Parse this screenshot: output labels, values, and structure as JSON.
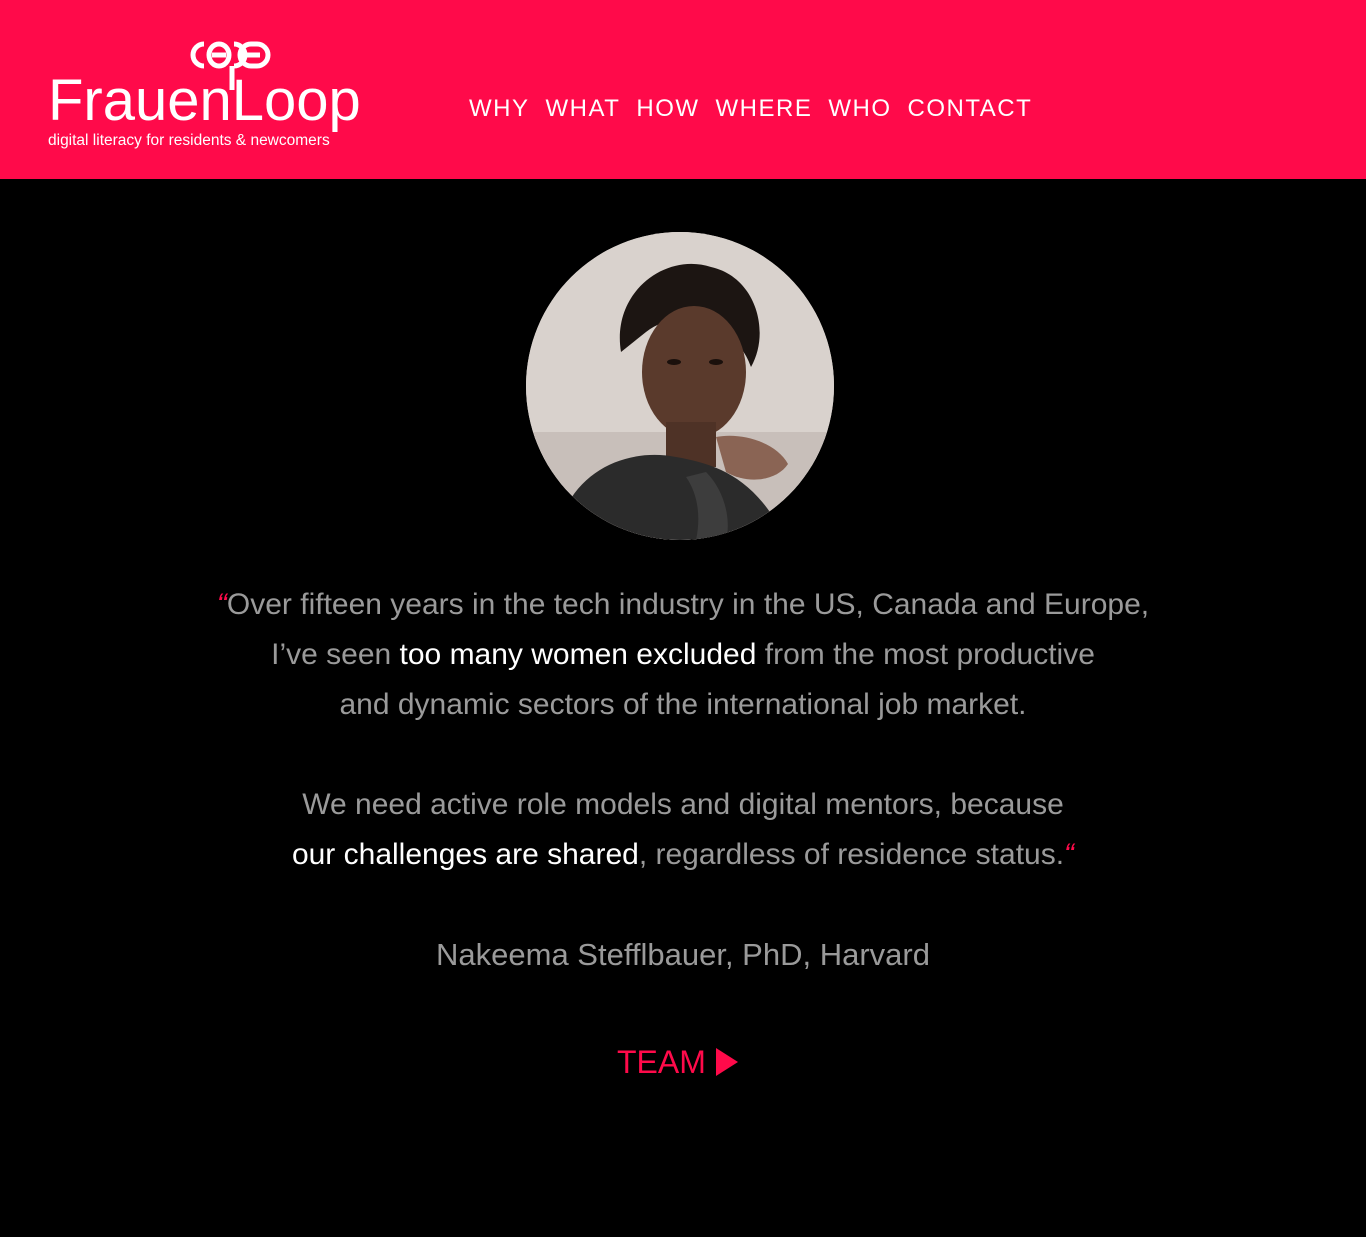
{
  "colors": {
    "brand": "#ff0a4a",
    "background": "#000000",
    "text_muted": "#9a9a9a",
    "text_highlight": "#ffffff"
  },
  "logo": {
    "name": "FrauenLoop",
    "tagline": "digital literacy for residents & newcomers",
    "icon": "chain-links-icon"
  },
  "nav": {
    "items": [
      {
        "label": "WHY"
      },
      {
        "label": "WHAT"
      },
      {
        "label": "HOW"
      },
      {
        "label": "WHERE"
      },
      {
        "label": "WHO"
      },
      {
        "label": "CONTACT"
      }
    ]
  },
  "testimonial": {
    "open_mark": "“",
    "close_mark": "“",
    "line1": "Over fifteen years in the tech industry in the US, Canada and Europe,",
    "line2_pre": "I’ve seen ",
    "line2_hl": "too many women excluded",
    "line2_post": " from the most productive",
    "line3": "and dynamic  sectors of the international job market.",
    "line4": "We need active role models and digital mentors, because",
    "line5_hl": "our challenges are shared",
    "line5_post": ", regardless of residence status.",
    "author": "Nakeema Stefflbauer, PhD, Harvard"
  },
  "team_link": {
    "label": "TEAM",
    "icon": "play-triangle-icon"
  }
}
